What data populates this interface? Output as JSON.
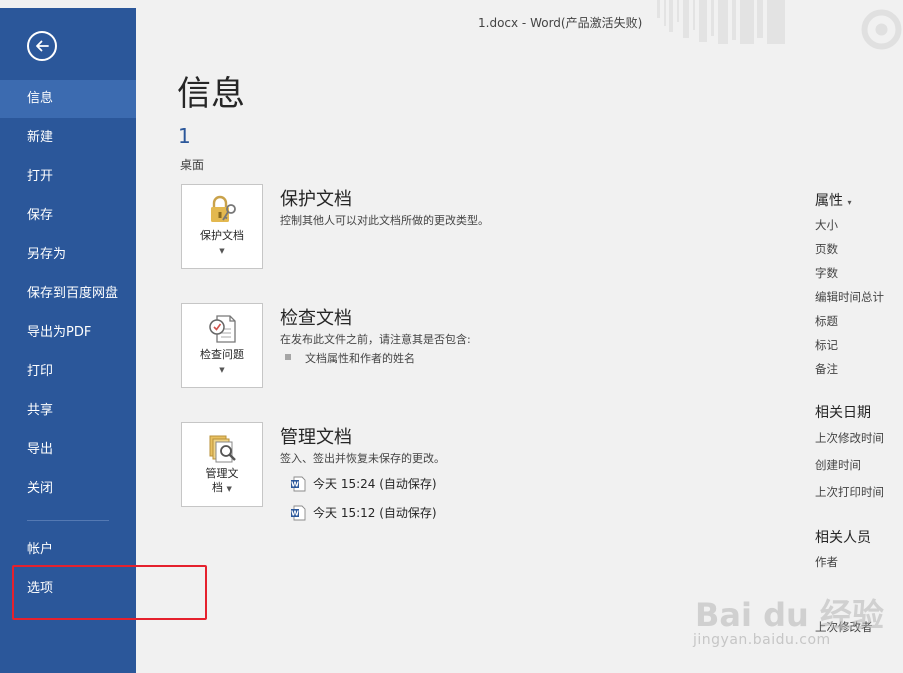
{
  "window": {
    "title": "1.docx - Word(产品激活失败)"
  },
  "sidebar": {
    "items": [
      {
        "label": "信息",
        "active": true
      },
      {
        "label": "新建"
      },
      {
        "label": "打开"
      },
      {
        "label": "保存"
      },
      {
        "label": "另存为"
      },
      {
        "label": "保存到百度网盘"
      },
      {
        "label": "导出为PDF"
      },
      {
        "label": "打印"
      },
      {
        "label": "共享"
      },
      {
        "label": "导出"
      },
      {
        "label": "关闭"
      }
    ],
    "bottom_items": [
      {
        "label": "帐户"
      },
      {
        "label": "选项"
      }
    ]
  },
  "main": {
    "title": "信息",
    "doc_name": "1",
    "doc_location": "桌面",
    "protect": {
      "tile_label": "保护文档",
      "title": "保护文档",
      "desc": "控制其他人可以对此文档所做的更改类型。"
    },
    "inspect": {
      "tile_label": "检查问题",
      "title": "检查文档",
      "desc": "在发布此文件之前，请注意其是否包含:",
      "bullet": "文档属性和作者的姓名"
    },
    "manage": {
      "tile_label_1": "管理文",
      "tile_label_2": "档",
      "title": "管理文档",
      "desc": "签入、签出并恢复未保存的更改。",
      "versions": [
        "今天 15:24 (自动保存)",
        "今天 15:12 (自动保存)"
      ]
    }
  },
  "properties": {
    "header": "属性",
    "items": [
      "大小",
      "页数",
      "字数",
      "编辑时间总计",
      "标题",
      "标记",
      "备注"
    ],
    "dates_header": "相关日期",
    "dates": [
      "上次修改时间",
      "创建时间",
      "上次打印时间"
    ],
    "people_header": "相关人员",
    "people": [
      "作者",
      "上次修改者"
    ]
  },
  "watermark": {
    "brand": "Bai du 经验",
    "url": "jingyan.baidu.com"
  },
  "colors": {
    "sidebar": "#2b579a",
    "sidebar_active": "#3c6bb0",
    "highlight_box": "#e5212d",
    "background": "#f1f1f1"
  }
}
